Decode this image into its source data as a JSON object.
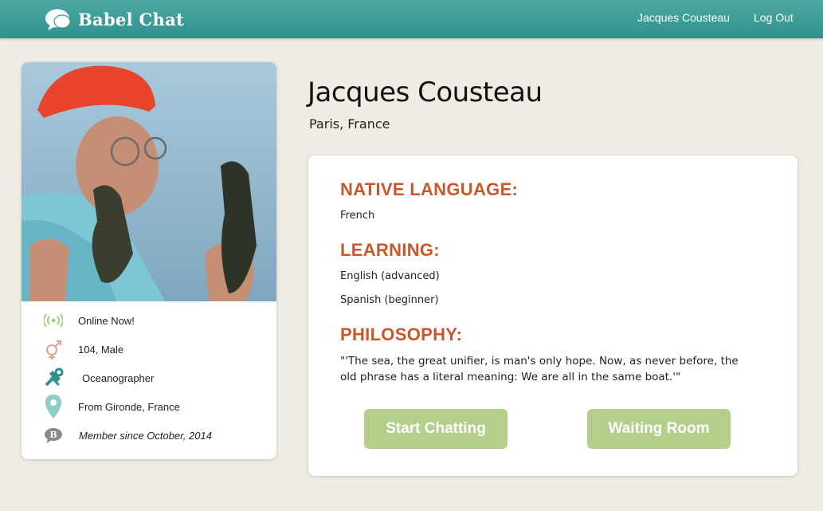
{
  "header": {
    "app_name": "Babel Chat",
    "user_link": "Jacques Cousteau",
    "logout_link": "Log Out"
  },
  "sidebar": {
    "status": "Online Now!",
    "age_gender": "104, Male",
    "occupation": "Oceanographer",
    "origin": "From Gironde, France",
    "member_since": "Member since October, 2014"
  },
  "profile": {
    "name": "Jacques Cousteau",
    "location": "Paris, France"
  },
  "details": {
    "native_title": "NATIVE LANGUAGE:",
    "native_value": "French",
    "learning_title": "LEARNING:",
    "learning_items": [
      "English (advanced)",
      "Spanish (beginner)"
    ],
    "philosophy_title": "PHILOSOPHY:",
    "philosophy_text": "\"'The sea, the great unifier, is man's only hope. Now, as never before, the old phrase has a literal meaning: We are all in the same boat.'\""
  },
  "actions": {
    "start_chatting": "Start Chatting",
    "waiting_room": "Waiting Room"
  },
  "colors": {
    "header": "#3a9a95",
    "accent_orange": "#c8572a",
    "button_green": "#b3cf8b",
    "background": "#efede3"
  },
  "icons": [
    "chat-bubble-icon",
    "online-signal-icon",
    "gender-icon",
    "tools-icon",
    "location-pin-icon",
    "babel-member-icon"
  ]
}
